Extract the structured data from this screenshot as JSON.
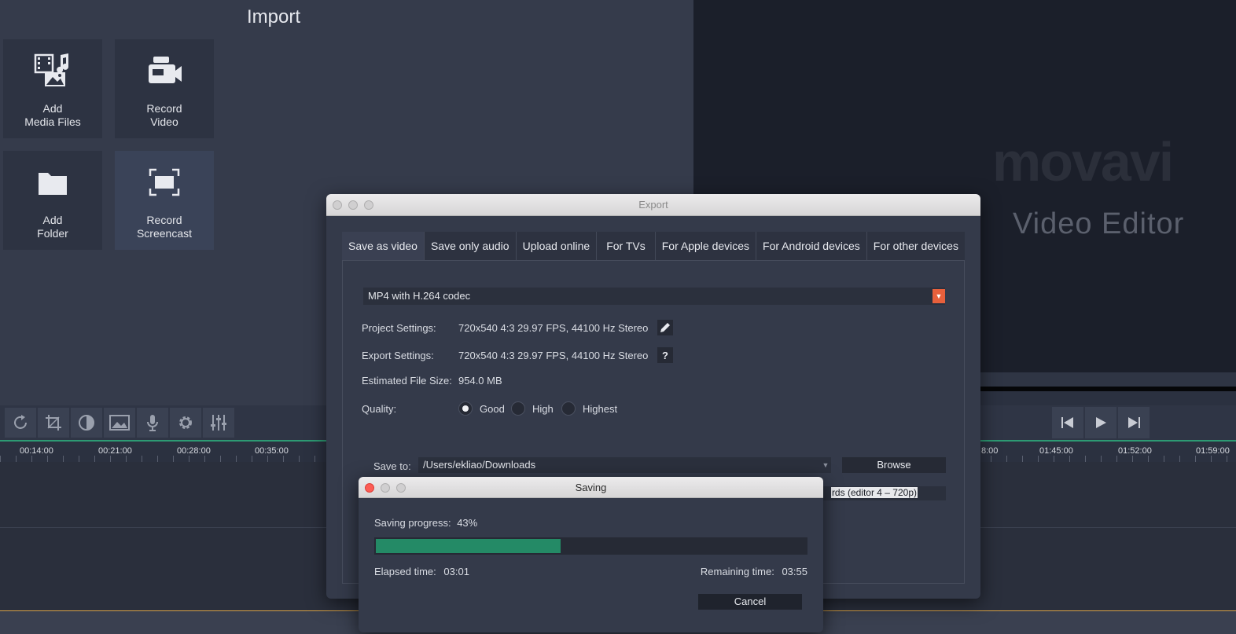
{
  "import": {
    "title": "Import",
    "tiles": [
      {
        "label": "Add\nMedia Files",
        "icon": "media-files-icon"
      },
      {
        "label": "Record\nVideo",
        "icon": "video-camera-icon"
      },
      {
        "label": "Add\nFolder",
        "icon": "folder-icon"
      },
      {
        "label": "Record\nScreencast",
        "icon": "screencast-icon"
      }
    ]
  },
  "preview": {
    "logo": "movavi",
    "subtitle": "Video Editor"
  },
  "toolbar": {
    "tools": [
      "rotate-icon",
      "crop-icon",
      "color-adjust-icon",
      "image-icon",
      "microphone-icon",
      "gear-icon",
      "equalizer-icon"
    ],
    "player": [
      "skip-back-icon",
      "play-icon",
      "skip-forward-icon"
    ]
  },
  "timeline": {
    "ticks_left": [
      "00:14:00",
      "00:21:00",
      "00:28:00",
      "00:35:00"
    ],
    "ticks_right": [
      "8:00",
      "01:45:00",
      "01:52:00",
      "01:59:00"
    ]
  },
  "export": {
    "title": "Export",
    "tabs": [
      "Save as video",
      "Save only audio",
      "Upload online",
      "For TVs",
      "For Apple devices",
      "For Android devices",
      "For other devices"
    ],
    "format": "MP4 with H.264 codec",
    "project_settings_label": "Project Settings:",
    "project_settings_value": "720x540 4:3 29.97 FPS, 44100 Hz Stereo",
    "export_settings_label": "Export Settings:",
    "export_settings_value": "720x540 4:3 29.97 FPS, 44100 Hz Stereo",
    "help_label": "?",
    "file_size_label": "Estimated File Size:",
    "file_size_value": "954.0 MB",
    "quality_label": "Quality:",
    "quality_options": [
      "Good",
      "High",
      "Highest"
    ],
    "quality_selected": "Good",
    "save_to_label": "Save to:",
    "save_to_path": "/Users/ekliao/Downloads",
    "browse_label": "Browse",
    "filename_visible": "rds (editor 4 – 720p)"
  },
  "saving": {
    "title": "Saving",
    "progress_label": "Saving progress:",
    "progress_value": "43%",
    "progress_fraction": 0.43,
    "elapsed_label": "Elapsed time:",
    "elapsed_value": "03:01",
    "remaining_label": "Remaining time:",
    "remaining_value": "03:55",
    "cancel_label": "Cancel"
  },
  "colors": {
    "accent_green": "#248a66",
    "dropdown_orange": "#e8603c",
    "close_red": "#fc5c54"
  }
}
